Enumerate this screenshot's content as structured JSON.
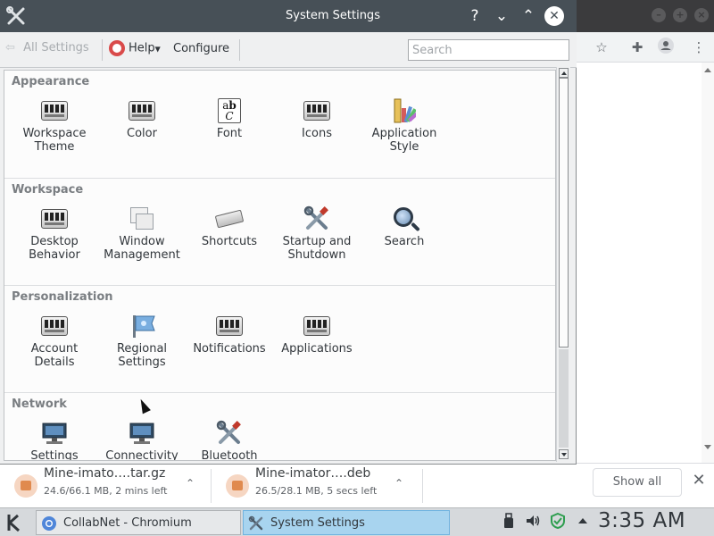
{
  "ss_window": {
    "title": "System Settings",
    "titlebar_buttons": [
      "?",
      "⌄",
      "⌃",
      "✕"
    ]
  },
  "ss_toolbar": {
    "back_label": "All Settings",
    "help_label": "Help",
    "configure_label": "Configure",
    "search_placeholder": "Search"
  },
  "categories": [
    {
      "title": "Appearance",
      "modules": [
        {
          "label": "Workspace Theme",
          "icon": "workspace-theme-icon"
        },
        {
          "label": "Color",
          "icon": "color-icon"
        },
        {
          "label": "Font",
          "icon": "font-icon",
          "glyph_a": "a",
          "glyph_b": "b",
          "glyph_c": "C"
        },
        {
          "label": "Icons",
          "icon": "icons-icon"
        },
        {
          "label": "Application Style",
          "icon": "application-style-icon"
        }
      ]
    },
    {
      "title": "Workspace",
      "modules": [
        {
          "label": "Desktop Behavior",
          "icon": "desktop-behavior-icon"
        },
        {
          "label": "Window Management",
          "icon": "window-management-icon"
        },
        {
          "label": "Shortcuts",
          "icon": "shortcuts-icon"
        },
        {
          "label": "Startup and Shutdown",
          "icon": "startup-shutdown-icon"
        },
        {
          "label": "Search",
          "icon": "search-icon"
        }
      ]
    },
    {
      "title": "Personalization",
      "modules": [
        {
          "label": "Account Details",
          "icon": "account-details-icon"
        },
        {
          "label": "Regional Settings",
          "icon": "regional-settings-icon"
        },
        {
          "label": "Notifications",
          "icon": "notifications-icon"
        },
        {
          "label": "Applications",
          "icon": "applications-icon"
        }
      ]
    },
    {
      "title": "Network",
      "modules": [
        {
          "label": "Settings",
          "icon": "network-settings-icon"
        },
        {
          "label": "Connectivity",
          "icon": "connectivity-icon"
        },
        {
          "label": "Bluetooth",
          "icon": "bluetooth-icon"
        }
      ]
    }
  ],
  "downloads": [
    {
      "name": "Mine-imato….tar.gz",
      "status": "24.6/66.1 MB, 2 mins left"
    },
    {
      "name": "Mine-imator….deb",
      "status": "26.5/28.1 MB, 5 secs left"
    }
  ],
  "shelf": {
    "show_all_label": "Show all",
    "close_glyph": "✕"
  },
  "taskbar": {
    "tasks": [
      {
        "label": "CollabNet - Chromium",
        "icon": "chromium-icon",
        "active": false
      },
      {
        "label": "System Settings",
        "icon": "system-settings-icon",
        "active": true
      }
    ],
    "clock": "3:35 AM"
  },
  "colors": {
    "titlebar": "#475057",
    "active_task": "#a8d4ef",
    "download_accent": "#e08a4e"
  }
}
